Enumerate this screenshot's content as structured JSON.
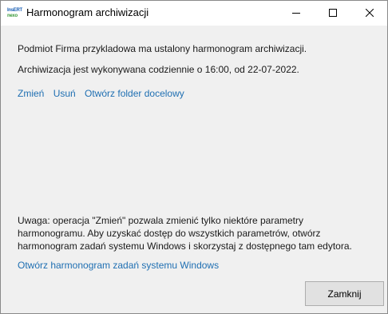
{
  "window": {
    "title": "Harmonogram archiwizacji",
    "app_icon_text_top": "InsERT",
    "app_icon_text_bottom": "nexo",
    "icons": [
      "app-logo",
      "minimize-icon",
      "maximize-icon",
      "close-icon"
    ]
  },
  "main": {
    "line1": "Podmiot Firma przykladowa ma ustalony harmonogram archiwizacji.",
    "line2": "Archiwizacja jest wykonywana codziennie o 16:00, od 22-07-2022."
  },
  "actions": {
    "change": "Zmień",
    "delete": "Usuń",
    "open_folder": "Otwórz folder docelowy"
  },
  "note": {
    "lines": [
      "Uwaga: operacja \"Zmień\" pozwala zmienić tylko niektóre parametry",
      "harmonogramu. Aby uzyskać dostęp do wszystkich parametrów, otwórz",
      "harmonogram zadań systemu Windows i skorzystaj z dostępnego tam edytora."
    ],
    "link": "Otwórz harmonogram zadań systemu Windows"
  },
  "footer": {
    "close_label": "Zamknij"
  },
  "colors": {
    "link": "#1f6fb2",
    "dialog_bg": "#f0f0f0",
    "titlebar_bg": "#ffffff"
  }
}
